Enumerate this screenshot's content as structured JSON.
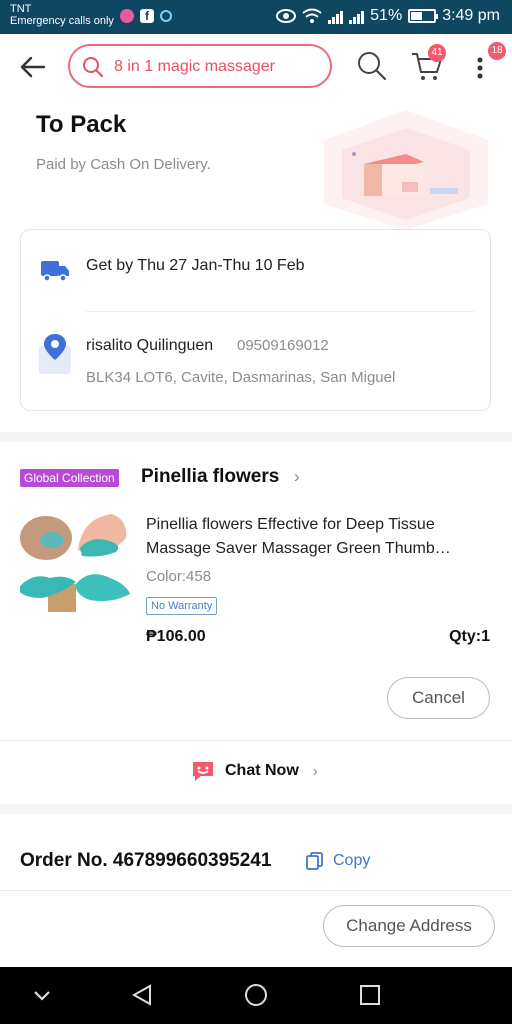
{
  "status_bar": {
    "carrier": "TNT",
    "carrier_sub": "Emergency calls only",
    "battery_percent": "51%",
    "battery_level": 0.51,
    "time": "3:49 pm"
  },
  "top_nav": {
    "search_text": "8 in 1 magic massager",
    "cart_badge": "41",
    "more_badge": "18"
  },
  "order_status": {
    "title": "To Pack",
    "subtitle": "Paid by Cash On Delivery."
  },
  "delivery": {
    "get_by": "Get by Thu 27 Jan-Thu 10 Feb",
    "name": "risalito Quilinguen",
    "phone": "09509169012",
    "address": "BLK34 LOT6, Cavite, Dasmarinas, San Miguel"
  },
  "store": {
    "tag": "Global Collection",
    "name": "Pinellia flowers"
  },
  "item": {
    "title_line1": "Pinellia flowers Effective for Deep Tissue",
    "title_line2": "Massage Saver Massager Green Thumb…",
    "color": "Color:458",
    "warranty": "No Warranty",
    "price": "₱106.00",
    "qty": "Qty:1"
  },
  "actions": {
    "cancel_label": "Cancel",
    "chat_label": "Chat Now",
    "change_address_label": "Change Address"
  },
  "order": {
    "number": "Order No. 467899660395241",
    "copy_label": "Copy"
  },
  "colors": {
    "accent": "#f35a6c",
    "status_bar": "#0f4661",
    "store_tag": "#b94ad6",
    "link": "#3d78c9"
  },
  "icons": [
    "back-arrow-icon",
    "search-icon",
    "cart-icon",
    "more-icon",
    "truck-icon",
    "location-pin-icon",
    "chat-icon",
    "copy-icon",
    "chevron-right-icon"
  ]
}
